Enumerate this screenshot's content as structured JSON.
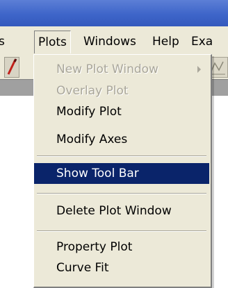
{
  "menubar": {
    "items": [
      "s",
      "Plots",
      "Windows",
      "Help",
      "Exa"
    ]
  },
  "plots_menu": {
    "items": [
      {
        "label": "New Plot Window",
        "enabled": false,
        "submenu": true
      },
      {
        "label": "Overlay Plot",
        "enabled": false
      },
      {
        "label": "Modify Plot",
        "enabled": true
      },
      {
        "label": "Modify Axes",
        "enabled": true
      },
      {
        "label": "Show Tool Bar",
        "enabled": true,
        "highlighted": true
      },
      {
        "label": "Delete Plot Window",
        "enabled": true
      },
      {
        "label": "Property Plot",
        "enabled": true
      },
      {
        "label": "Curve Fit",
        "enabled": true
      }
    ]
  },
  "colors": {
    "titlebar": "#3e65c9",
    "menu_bg": "#ece9d8",
    "highlight": "#0a246a",
    "disabled_text": "#a9a69a"
  }
}
